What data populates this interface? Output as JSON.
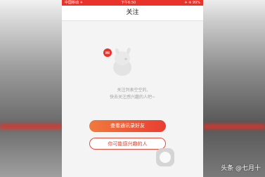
{
  "statusbar": {
    "carrier": "中国移动 ✈",
    "time": "下午6:50",
    "battery": "✈ ❊ 99%"
  },
  "header": {
    "title": "关注"
  },
  "mascot": {
    "badge": "Hi"
  },
  "empty_state": {
    "line1": "关注列表空空的,",
    "line2": "快去关注感兴趣的人吧~"
  },
  "buttons": {
    "view_contacts": "查看通讯录好友",
    "interested_people": "你可能感兴趣的人"
  },
  "watermark": "头条 @七月十",
  "colors": {
    "accent": "#e8322a",
    "gradient_start": "#f07a3c",
    "gradient_end": "#ea3d32"
  }
}
